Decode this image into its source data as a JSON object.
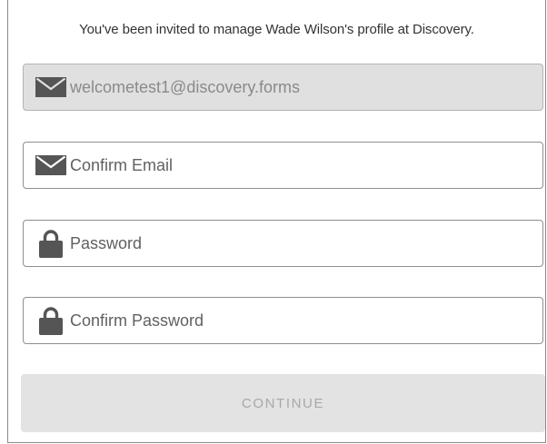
{
  "intro_text": "You've been invited to manage Wade Wilson's profile at Discovery.",
  "form": {
    "email": {
      "value": "welcometest1@discovery.forms",
      "icon": "envelope-icon",
      "disabled": true
    },
    "confirm_email": {
      "placeholder": "Confirm Email",
      "value": "",
      "icon": "envelope-icon"
    },
    "password": {
      "placeholder": "Password",
      "value": "",
      "icon": "lock-icon"
    },
    "confirm_password": {
      "placeholder": "Confirm Password",
      "value": "",
      "icon": "lock-icon"
    }
  },
  "continue_label": "CONTINUE",
  "colors": {
    "icon": "#555555",
    "disabled_field_bg": "#e0e0e0",
    "disabled_button_bg": "#e3e3e3",
    "disabled_button_text": "#a8a8a8"
  }
}
